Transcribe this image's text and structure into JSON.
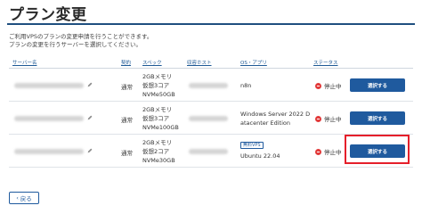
{
  "page": {
    "title": "プラン変更",
    "desc_line1": "ご利用VPSのプランの変更申請を行うことができます。",
    "desc_line2": "プランの変更を行うサーバーを選択してください。"
  },
  "table": {
    "headers": {
      "server_name": "サーバー名",
      "type": "契約",
      "spec": "スペック",
      "host": "収容ホスト",
      "os_app": "OS・アプリ",
      "status": "ステータス"
    },
    "rows": [
      {
        "type": "通常",
        "spec_memory": "2GBメモリ",
        "spec_cpu": "仮想3コア",
        "spec_disk": "NVMe50GB",
        "os_line1": "n8n",
        "os_line2": "",
        "badge": "",
        "status": "停止中",
        "button": "選択する"
      },
      {
        "type": "通常",
        "spec_memory": "2GBメモリ",
        "spec_cpu": "仮想3コア",
        "spec_disk": "NVMe100GB",
        "os_line1": "Windows Server 2022 D",
        "os_line2": "atacenter Edition",
        "badge": "",
        "status": "停止中",
        "button": "選択する"
      },
      {
        "type": "通常",
        "spec_memory": "2GBメモリ",
        "spec_cpu": "仮想2コア",
        "spec_disk": "NVMe30GB",
        "os_line1": "Ubuntu 22.04",
        "os_line2": "",
        "badge": "無料VPS",
        "status": "停止中",
        "button": "選択する"
      }
    ]
  },
  "back_button": {
    "label": "戻る",
    "icon": "chevron-left-icon"
  },
  "colors": {
    "accent": "#1f5a9e",
    "status_stopped": "#e23b3b",
    "highlight": "#e51f2a"
  }
}
